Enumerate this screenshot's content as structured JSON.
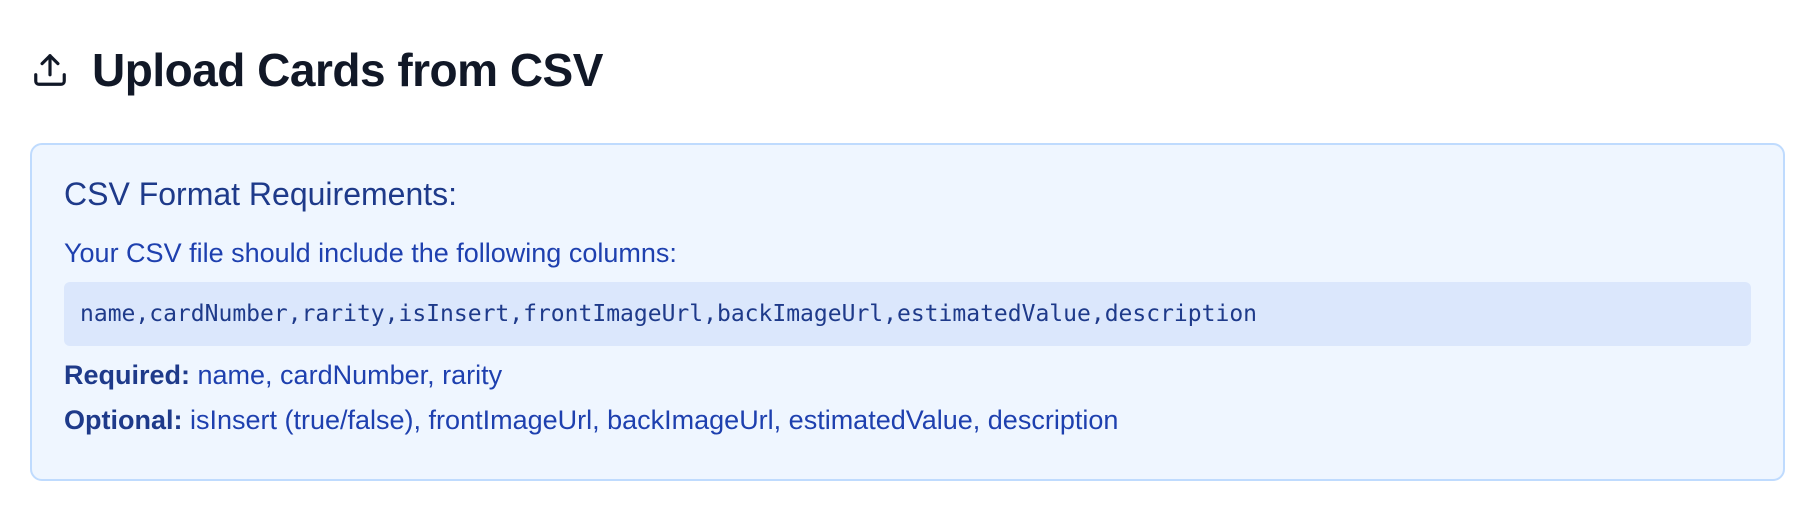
{
  "header": {
    "icon": "upload-icon",
    "title": "Upload Cards from CSV"
  },
  "requirements": {
    "heading": "CSV Format Requirements:",
    "intro": "Your CSV file should include the following columns:",
    "columns_code": "name,cardNumber,rarity,isInsert,frontImageUrl,backImageUrl,estimatedValue,description",
    "required_label": "Required:",
    "required_text": " name, cardNumber, rarity",
    "optional_label": "Optional:",
    "optional_text": " isInsert (true/false), frontImageUrl, backImageUrl, estimatedValue, description"
  },
  "colors": {
    "box_background": "#eff6ff",
    "box_border": "#bfdbfe",
    "text_blue": "#1e40af",
    "code_background": "#dbe7fc"
  }
}
